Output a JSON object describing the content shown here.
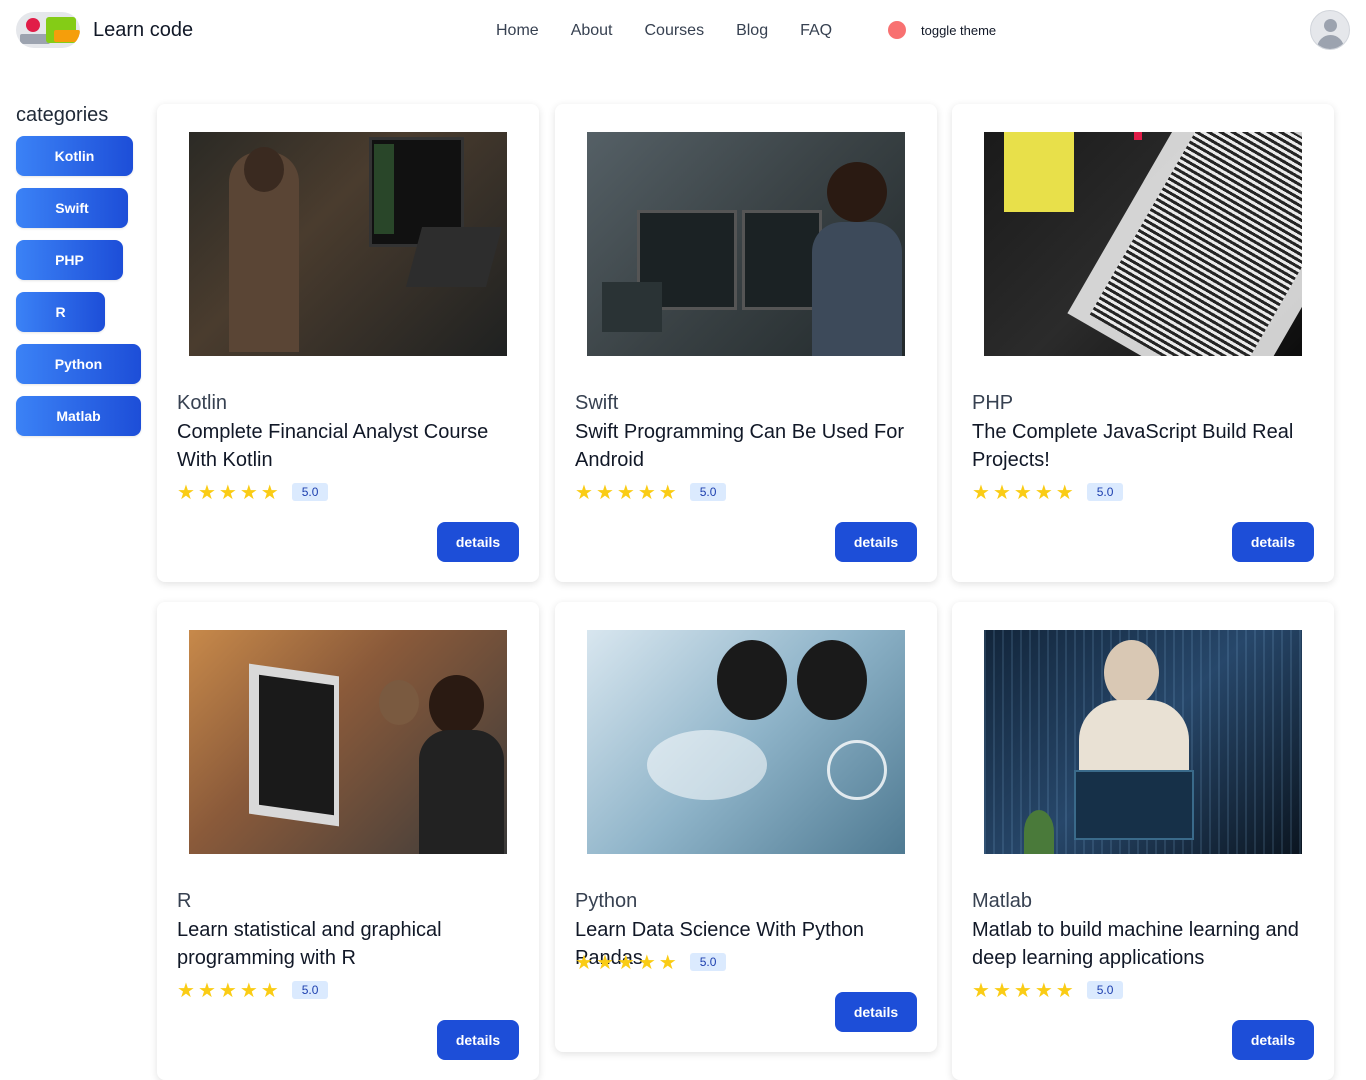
{
  "header": {
    "brand": "Learn code",
    "nav": [
      "Home",
      "About",
      "Courses",
      "Blog",
      "FAQ"
    ],
    "theme_toggle": "toggle theme"
  },
  "sidebar": {
    "title": "categories",
    "items": [
      "Kotlin",
      "Swift",
      "PHP",
      "R",
      "Python",
      "Matlab"
    ]
  },
  "courses": [
    {
      "category": "Kotlin",
      "title": "Complete Financial Analyst Course With Kotlin",
      "rating": "5.0",
      "button": "details"
    },
    {
      "category": "Swift",
      "title": "Swift Programming Can Be Used For Android",
      "rating": "5.0",
      "button": "details"
    },
    {
      "category": "PHP",
      "title": "The Complete JavaScript Build Real Projects!",
      "rating": "5.0",
      "button": "details"
    },
    {
      "category": "R",
      "title": "Learn statistical and graphical programming with R",
      "rating": "5.0",
      "button": "details"
    },
    {
      "category": "Python",
      "title": "Learn Data Science With Python Pandas",
      "rating": "5.0",
      "button": "details"
    },
    {
      "category": "Matlab",
      "title": "Matlab to build machine learning and deep learning applications",
      "rating": "5.0",
      "button": "details"
    }
  ],
  "colors": {
    "primary": "#1d4ed8",
    "star": "#facc15",
    "theme_dot": "#f87171"
  }
}
